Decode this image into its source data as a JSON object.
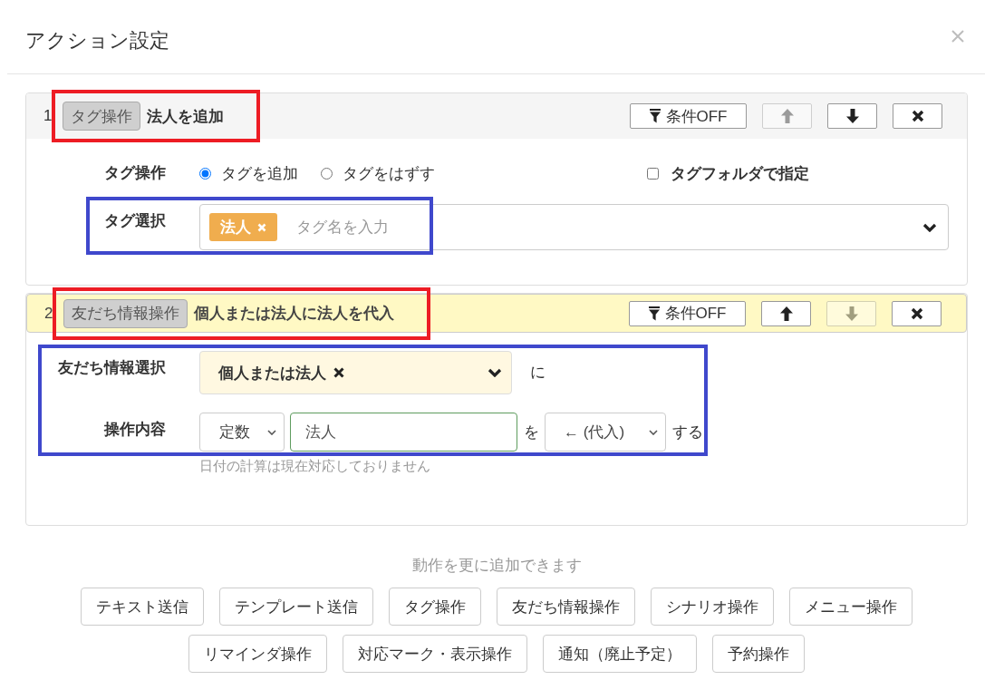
{
  "dialog": {
    "title": "アクション設定"
  },
  "actions": [
    {
      "number": "1",
      "type_badge": "タグ操作",
      "title": "法人を追加",
      "selected": false,
      "condition_button": "条件OFF",
      "move_up": {
        "disabled": true
      },
      "move_down": {
        "disabled": false
      },
      "kind": "tag",
      "operation": {
        "label": "タグ操作",
        "options": [
          {
            "label": "タグを追加",
            "selected": true
          },
          {
            "label": "タグをはずす",
            "selected": false
          }
        ]
      },
      "folder_option": {
        "label": "タグフォルダで指定",
        "checked": false
      },
      "tag_select": {
        "label": "タグ選択",
        "tags": [
          {
            "label": "法人"
          }
        ],
        "placeholder": "タグ名を入力"
      },
      "highlights": [
        {
          "kind": "header",
          "color": "#ed1c24"
        },
        {
          "kind": "tag_select",
          "color": "#3f48cc"
        }
      ]
    },
    {
      "number": "2",
      "type_badge": "友だち情報操作",
      "title": "個人または法人に法人を代入",
      "selected": true,
      "condition_button": "条件OFF",
      "move_up": {
        "disabled": false
      },
      "move_down": {
        "disabled": true
      },
      "kind": "friend_info",
      "target": {
        "label": "友だち情報選択",
        "value": "個人または法人",
        "suffix": "に"
      },
      "operation": {
        "label": "操作内容",
        "source": "定数",
        "value": "法人",
        "particle": "を",
        "operator": "← (代入)",
        "suffix": "する",
        "note": "日付の計算は現在対応しておりません"
      },
      "highlights": [
        {
          "kind": "header",
          "color": "#ed1c24"
        },
        {
          "kind": "fields",
          "color": "#3f48cc"
        }
      ]
    }
  ],
  "add_more": {
    "hint": "動作を更に追加できます",
    "buttons": [
      "テキスト送信",
      "テンプレート送信",
      "タグ操作",
      "友だち情報操作",
      "シナリオ操作",
      "メニュー操作",
      "リマインダ操作",
      "対応マーク・表示操作",
      "通知（廃止予定）",
      "予約操作"
    ]
  }
}
